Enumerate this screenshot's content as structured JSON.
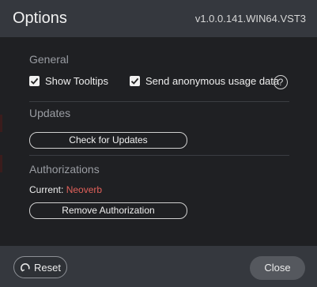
{
  "window": {
    "title": "Options",
    "version": "v1.0.0.141.WIN64.VST3"
  },
  "general": {
    "label": "General",
    "show_tooltips": {
      "label": "Show Tooltips",
      "checked": true
    },
    "send_usage": {
      "label": "Send anonymous usage data",
      "checked": true
    },
    "help_icon": "?"
  },
  "updates": {
    "label": "Updates",
    "check_button": "Check for Updates"
  },
  "authorizations": {
    "label": "Authorizations",
    "current_label": "Current:",
    "current_value": "Neoverb",
    "remove_button": "Remove Authorization"
  },
  "footer": {
    "reset_label": "Reset",
    "close_label": "Close"
  },
  "colors": {
    "accent_red": "#e0605a",
    "panel": "#1f2023",
    "bar": "#35383e"
  }
}
